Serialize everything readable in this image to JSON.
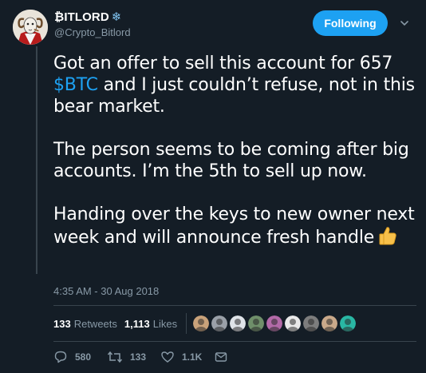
{
  "user": {
    "name": "₿ITLORD",
    "name_emoji": "❄",
    "handle": "@Crypto_Bitlord",
    "follow_label": "Following",
    "avatar_icon": "ram-mascot-avatar"
  },
  "tweet": {
    "p1_before": "Got an offer to sell this account for 657 ",
    "cashtag": "$BTC",
    "p1_after": " and I just couldn’t refuse, not in this bear market.",
    "p2": "The person seems to be coming after big accounts. I’m the 5th to sell up now.",
    "p3": "Handing over the keys to new owner next week and will announce fresh handle",
    "p3_emoji": "thumbs-up",
    "timestamp": "4:35 AM - 30 Aug 2018"
  },
  "stats": {
    "retweets_count": "133",
    "retweets_label": "Retweets",
    "likes_count": "1,113",
    "likes_label": "Likes"
  },
  "likers": [
    {
      "icon": "liker-avatar-1",
      "color": "#c9a27a"
    },
    {
      "icon": "liker-avatar-2",
      "color": "#9aa0a8"
    },
    {
      "icon": "liker-avatar-3",
      "color": "#dfe3e8"
    },
    {
      "icon": "liker-avatar-4",
      "color": "#6f8f6a"
    },
    {
      "icon": "liker-avatar-5",
      "color": "#b36aa8"
    },
    {
      "icon": "liker-avatar-6",
      "color": "#e9e9e9"
    },
    {
      "icon": "liker-avatar-7",
      "color": "#7d7d7d"
    },
    {
      "icon": "liker-avatar-8",
      "color": "#caa98a"
    },
    {
      "icon": "liker-avatar-9",
      "color": "#29b7a4"
    }
  ],
  "actions": {
    "replies": "580",
    "retweets": "133",
    "likes": "1.1K"
  },
  "colors": {
    "background": "#141d26",
    "accent": "#1da1f2",
    "muted": "#8899a6",
    "divider": "#38444d"
  }
}
